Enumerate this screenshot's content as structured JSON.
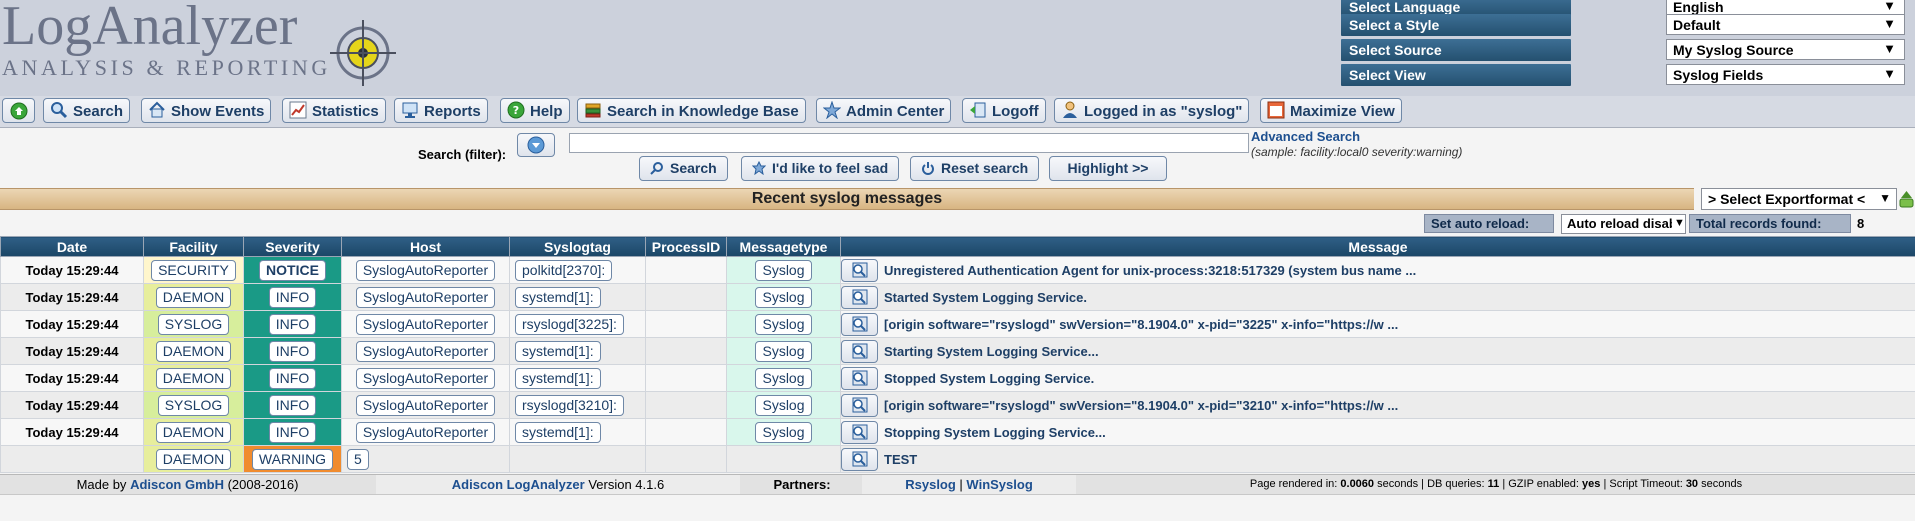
{
  "logo": {
    "title": "LogAnalyzer",
    "subtitle": "ANALYSIS & REPORTING"
  },
  "selectors": [
    {
      "label": "Select Language",
      "value": "English"
    },
    {
      "label": "Select a Style",
      "value": "Default"
    },
    {
      "label": "Select Source",
      "value": "My Syslog Source"
    },
    {
      "label": "Select View",
      "value": "Syslog Fields"
    }
  ],
  "toolbar": {
    "search": "Search",
    "show_events": "Show Events",
    "statistics": "Statistics",
    "reports": "Reports",
    "help": "Help",
    "kb": "Search in Knowledge Base",
    "admin": "Admin Center",
    "logoff": "Logoff",
    "logged_in": "Logged in as \"syslog\"",
    "maximize": "Maximize View"
  },
  "search": {
    "label": "Search (filter):",
    "value": "",
    "advanced_link": "Advanced Search",
    "sample": "(sample: facility:local0 severity:warning)",
    "search_btn": "Search",
    "feel_sad_btn": "I'd like to feel sad",
    "reset_btn": "Reset search",
    "highlight_btn": "Highlight >>"
  },
  "title": "Recent syslog messages",
  "export_select": "> Select Exportformat <",
  "reload": {
    "label": "Set auto reload:",
    "select": "Auto reload disabled",
    "total_label": "Total records found:",
    "total": "8"
  },
  "columns": [
    "Date",
    "Facility",
    "Severity",
    "Host",
    "Syslogtag",
    "ProcessID",
    "Messagetype",
    "Message"
  ],
  "rows": [
    {
      "date": "Today 15:29:44",
      "facility": "SECURITY",
      "severity": "NOTICE",
      "host": "SyslogAutoReporter",
      "tag": "polkitd[2370]:",
      "pid": "",
      "mtype": "Syslog",
      "message": "Unregistered Authentication Agent for unix-process:3218:517329 (system bus name ..."
    },
    {
      "date": "Today 15:29:44",
      "facility": "DAEMON",
      "severity": "INFO",
      "host": "SyslogAutoReporter",
      "tag": "systemd[1]:",
      "pid": "",
      "mtype": "Syslog",
      "message": "Started System Logging Service."
    },
    {
      "date": "Today 15:29:44",
      "facility": "SYSLOG",
      "severity": "INFO",
      "host": "SyslogAutoReporter",
      "tag": "rsyslogd[3225]:",
      "pid": "",
      "mtype": "Syslog",
      "message": "[origin software=\"rsyslogd\" swVersion=\"8.1904.0\" x-pid=\"3225\" x-info=\"https://w ..."
    },
    {
      "date": "Today 15:29:44",
      "facility": "DAEMON",
      "severity": "INFO",
      "host": "SyslogAutoReporter",
      "tag": "systemd[1]:",
      "pid": "",
      "mtype": "Syslog",
      "message": "Starting System Logging Service..."
    },
    {
      "date": "Today 15:29:44",
      "facility": "DAEMON",
      "severity": "INFO",
      "host": "SyslogAutoReporter",
      "tag": "systemd[1]:",
      "pid": "",
      "mtype": "Syslog",
      "message": "Stopped System Logging Service."
    },
    {
      "date": "Today 15:29:44",
      "facility": "SYSLOG",
      "severity": "INFO",
      "host": "SyslogAutoReporter",
      "tag": "rsyslogd[3210]:",
      "pid": "",
      "mtype": "Syslog",
      "message": "[origin software=\"rsyslogd\" swVersion=\"8.1904.0\" x-pid=\"3210\" x-info=\"https://w ..."
    },
    {
      "date": "Today 15:29:44",
      "facility": "DAEMON",
      "severity": "INFO",
      "host": "SyslogAutoReporter",
      "tag": "systemd[1]:",
      "pid": "",
      "mtype": "Syslog",
      "message": "Stopping System Logging Service..."
    },
    {
      "date": "",
      "facility": "DAEMON",
      "severity": "WARNING",
      "host": "5",
      "tag": "",
      "pid": "",
      "mtype": "",
      "message": "TEST"
    }
  ],
  "footer": {
    "made_by_prefix": "Made by",
    "company": "Adiscon GmbH",
    "years": "(2008-2016)",
    "product": "Adiscon LogAnalyzer",
    "version": "Version 4.1.6",
    "partners_label": "Partners:",
    "partner1": "Rsyslog",
    "partner2": "WinSyslog",
    "rendered_label": "Page rendered in:",
    "rendered_value": "0.0060",
    "rendered_unit": "seconds",
    "db_label": "DB queries:",
    "db_value": "11",
    "gzip_label": "GZIP enabled:",
    "gzip_value": "yes",
    "timeout_label": "Script Timeout:",
    "timeout_value": "30",
    "timeout_unit": "seconds"
  },
  "colors": {
    "header_bg": "#ccd1dc",
    "bar_blue": "#24506f",
    "info": "#1a9a86",
    "warning": "#f08b2e",
    "link": "#1d4f8f"
  },
  "icons": [
    "home-icon",
    "search-icon",
    "home-house-icon",
    "chart-icon",
    "monitor-icon",
    "help-icon",
    "books-icon",
    "star-icon",
    "logoff-icon",
    "user-icon",
    "maximize-icon",
    "dropdown-circle-icon",
    "magnifier-icon",
    "power-icon",
    "export-icon",
    "message-detail-icon"
  ]
}
